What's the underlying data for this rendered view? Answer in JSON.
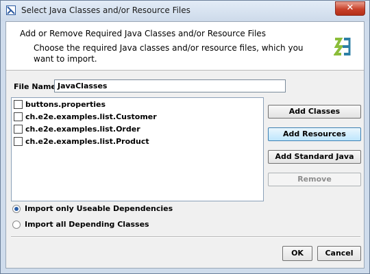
{
  "window": {
    "title": "Select Java Classes and/or Resource Files",
    "close_label": "✕"
  },
  "header": {
    "title": "Add or Remove Required Java Classes and/or Resource Files",
    "description": "Choose the required Java classes and/or resource files, which you want to import."
  },
  "file_name": {
    "label": "File Name:",
    "value": "JavaClasses"
  },
  "list": {
    "items": [
      {
        "label": "buttons.properties"
      },
      {
        "label": "ch.e2e.examples.list.Customer"
      },
      {
        "label": "ch.e2e.examples.list.Order"
      },
      {
        "label": "ch.e2e.examples.list.Product"
      }
    ]
  },
  "buttons": {
    "add_classes": "Add Classes",
    "add_resources": "Add Resources",
    "add_standard_java": "Add Standard Java",
    "remove": "Remove",
    "ok": "OK",
    "cancel": "Cancel"
  },
  "options": {
    "useable_label": "Import only Useable Dependencies",
    "useable_selected": true,
    "all_label": "Import all Depending Classes",
    "all_selected": false
  }
}
